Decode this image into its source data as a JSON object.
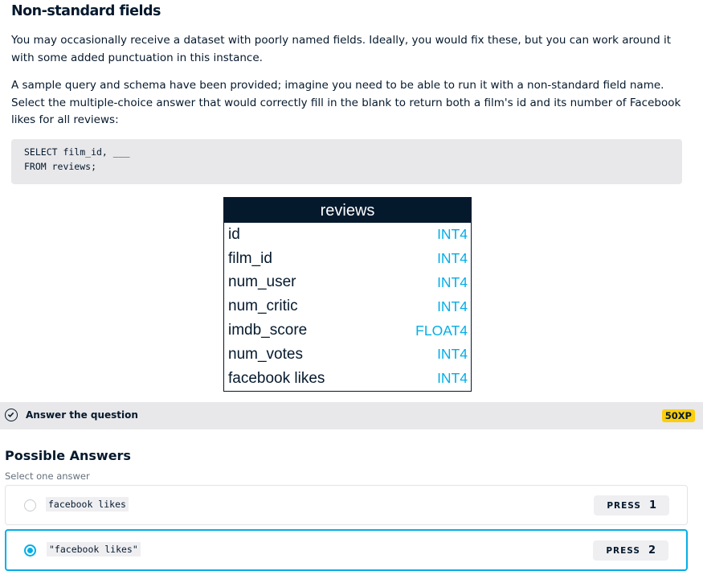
{
  "exercise": {
    "title": "Non-standard fields",
    "paragraph1": "You may occasionally receive a dataset with poorly named fields. Ideally, you would fix these, but you can work around it with some added punctuation in this instance.",
    "paragraph2": "A sample query and schema have been provided; imagine you need to be able to run it with a non-standard field name. Select the multiple-choice answer that would correctly fill in the blank to return both a film's id and its number of Facebook likes for all reviews:",
    "code": [
      "SELECT film_id, ___",
      "FROM reviews;"
    ]
  },
  "schema": {
    "table_name": "reviews",
    "rows": [
      {
        "field": "id",
        "type": "INT4"
      },
      {
        "field": "film_id",
        "type": "INT4"
      },
      {
        "field": "num_user",
        "type": "INT4"
      },
      {
        "field": "num_critic",
        "type": "INT4"
      },
      {
        "field": "imdb_score",
        "type": "FLOAT4"
      },
      {
        "field": "num_votes",
        "type": "INT4"
      },
      {
        "field": "facebook likes",
        "type": "INT4"
      }
    ]
  },
  "question_bar": {
    "label": "Answer the question",
    "xp": "50XP"
  },
  "answers": {
    "title": "Possible Answers",
    "subtitle": "Select one answer",
    "options": [
      {
        "text": "facebook likes",
        "press": "PRESS",
        "key": "1",
        "selected": false
      },
      {
        "text": "\"facebook likes\"",
        "press": "PRESS",
        "key": "2",
        "selected": true
      }
    ]
  },
  "colors": {
    "navy": "#05192d",
    "accent_blue": "#03aee8",
    "xp_yellow": "#fcce0d",
    "bar_gray": "#e8e8ea"
  }
}
